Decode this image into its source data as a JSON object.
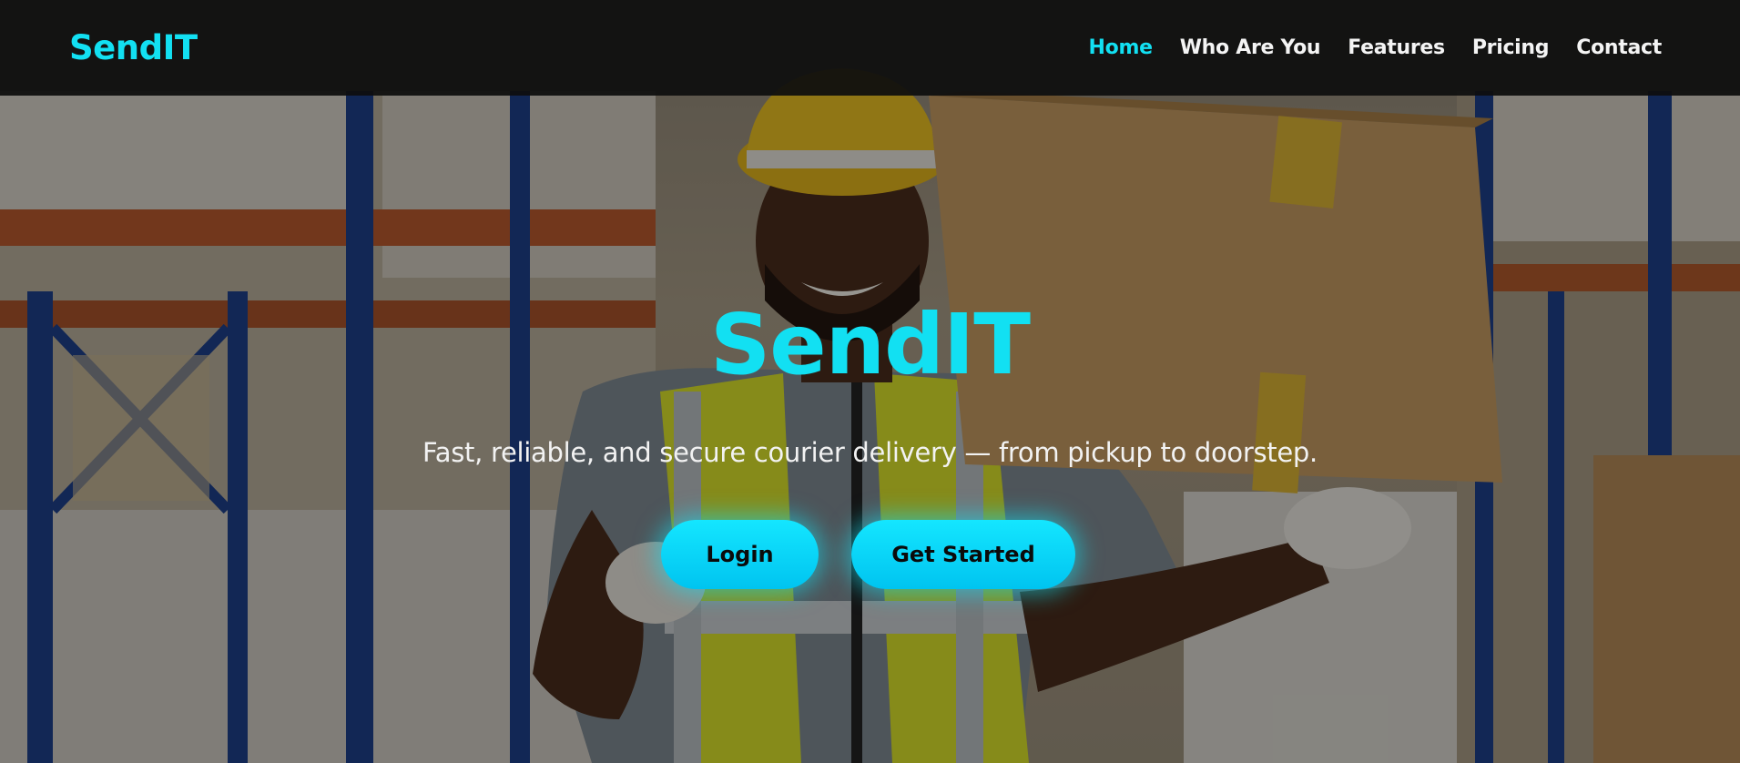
{
  "navbar": {
    "brand": "SendIT",
    "links": [
      {
        "label": "Home",
        "active": true
      },
      {
        "label": "Who Are You",
        "active": false
      },
      {
        "label": "Features",
        "active": false
      },
      {
        "label": "Pricing",
        "active": false
      },
      {
        "label": "Contact",
        "active": false
      }
    ]
  },
  "hero": {
    "title": "SendIT",
    "subtitle": "Fast, reliable, and secure courier delivery — from pickup to doorstep.",
    "buttons": {
      "login": "Login",
      "get_started": "Get Started"
    },
    "background_image": "warehouse-worker-carrying-box"
  },
  "colors": {
    "accent": "#12e0f2",
    "navbar_bg": "#0e0e0e",
    "button_text": "#0b0b0b"
  }
}
